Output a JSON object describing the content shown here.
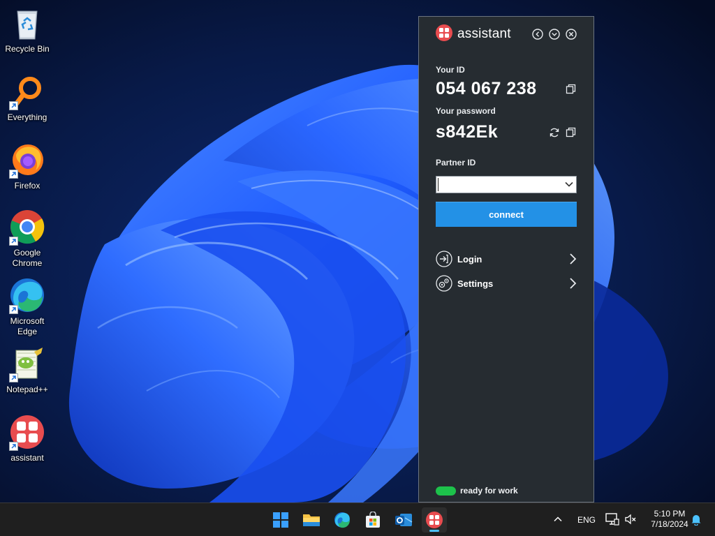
{
  "desktop": {
    "icons": [
      {
        "label": "Recycle Bin",
        "icon": "recycle-bin-icon"
      },
      {
        "label": "Everything",
        "icon": "everything-search-icon"
      },
      {
        "label": "Firefox",
        "icon": "firefox-icon"
      },
      {
        "label": "Google Chrome",
        "label_line1": "Google",
        "label_line2": "Chrome",
        "icon": "chrome-icon"
      },
      {
        "label": "Microsoft Edge",
        "label_line1": "Microsoft",
        "label_line2": "Edge",
        "icon": "edge-icon"
      },
      {
        "label": "Notepad++",
        "icon": "notepad-plus-plus-icon"
      },
      {
        "label": "assistant",
        "icon": "assistant-app-icon"
      }
    ]
  },
  "assistant": {
    "brand": "assistant",
    "your_id_label": "Your ID",
    "your_id": "054 067 238",
    "password_label": "Your password",
    "password": "s842Ek",
    "partner_id_label": "Partner ID",
    "partner_id_value": "",
    "connect_label": "connect",
    "menu": [
      {
        "label": "Login",
        "icon": "login-icon"
      },
      {
        "label": "Settings",
        "icon": "settings-icon"
      }
    ],
    "status": "ready for work",
    "colors": {
      "accent": "#2391e6",
      "status": "#1dc24b",
      "brand": "#e84c4f",
      "panel": "#262c31"
    }
  },
  "taskbar": {
    "apps": [
      "start-icon",
      "file-explorer-icon",
      "edge-icon",
      "store-icon",
      "outlook-icon",
      "assistant-app-icon"
    ],
    "language": "ENG",
    "time": "5:10 PM",
    "date": "7/18/2024"
  }
}
